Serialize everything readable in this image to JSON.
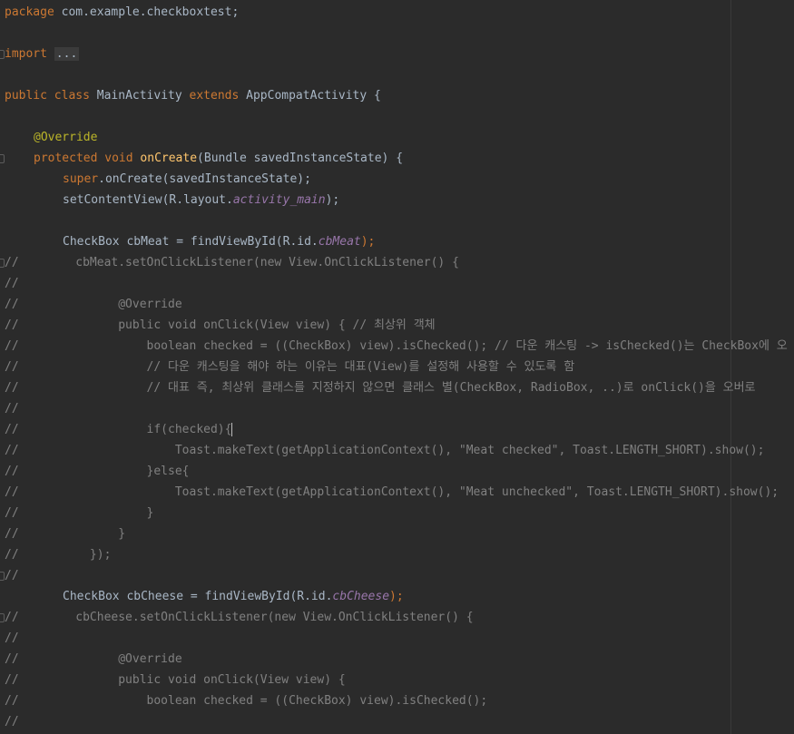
{
  "editor": {
    "line1": {
      "kw": "package",
      "rest": "com.example.checkboxtest;"
    },
    "line2": {
      "kw": "import",
      "fold": "..."
    },
    "line3": {
      "kw1": "public",
      "kw2": "class",
      "cls": "MainActivity",
      "kw3": "extends",
      "rest": "AppCompatActivity {"
    },
    "line4": {
      "anno": "@Override"
    },
    "line5": {
      "kw1": "protected",
      "kw2": "void",
      "method": "onCreate",
      "rest": "(Bundle savedInstanceState) {"
    },
    "line6": {
      "kw": "super",
      "rest": ".onCreate(savedInstanceState);"
    },
    "line7": {
      "pre": "setContentView(R.layout.",
      "field": "activity_main",
      "post": ");"
    },
    "line8": {
      "pre": "CheckBox cbMeat = findViewById(R.id.",
      "field": "cbMeat",
      "post": ");"
    },
    "comments": [
      "//        cbMeat.setOnClickListener(new View.OnClickListener() {",
      "//",
      "//              @Override",
      "//              public void onClick(View view) { // 최상위 객체",
      "//                  boolean checked = ((CheckBox) view).isChecked(); // 다운 캐스팅 -> isChecked()는 CheckBox에 오",
      "//                  // 다운 캐스팅을 해야 하는 이유는 대표(View)를 설정해 사용할 수 있도록 함",
      "//                  // 대표 즉, 최상위 클래스를 지정하지 않으면 클래스 별(CheckBox, RadioBox, ..)로 onClick()을 오버로",
      "//",
      "//                  if(checked){",
      "//                      Toast.makeText(getApplicationContext(), \"Meat checked\", Toast.LENGTH_SHORT).show();",
      "//                  }else{",
      "//                      Toast.makeText(getApplicationContext(), \"Meat unchecked\", Toast.LENGTH_SHORT).show();",
      "//                  }",
      "//              }",
      "//          });",
      "//"
    ],
    "line_cheese": {
      "pre": "CheckBox cbCheese = findViewById(R.id.",
      "field": "cbCheese",
      "post": ");"
    },
    "comments2": [
      "//        cbCheese.setOnClickListener(new View.OnClickListener() {",
      "//",
      "//              @Override",
      "//              public void onClick(View view) {",
      "//                  boolean checked = ((CheckBox) view).isChecked();",
      "//"
    ]
  },
  "colors": {
    "background": "#2b2b2b",
    "keyword": "#cc7832",
    "comment": "#808080",
    "method": "#ffc66d",
    "annotation": "#bbb529",
    "field": "#9876aa",
    "text": "#a9b7c6"
  }
}
